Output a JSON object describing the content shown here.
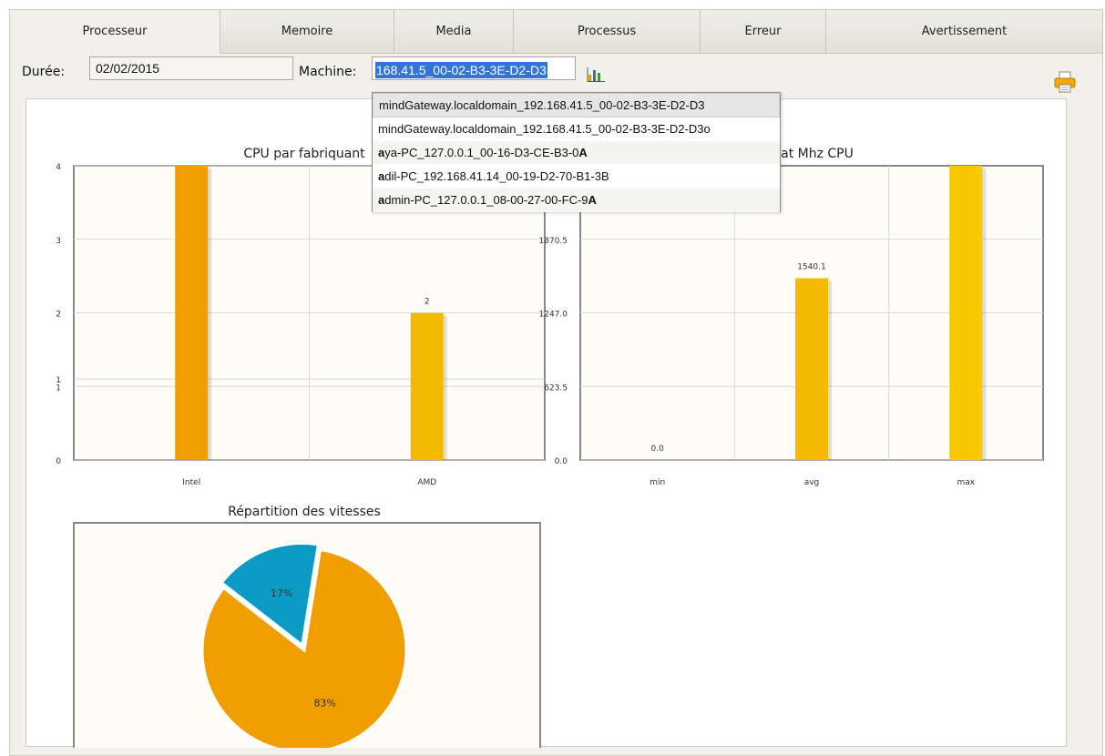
{
  "tabs": [
    "Processeur",
    "Memoire",
    "Media",
    "Processus",
    "Erreur",
    "Avertissement"
  ],
  "filter": {
    "duree_label": "Durée:",
    "duree_value": "02/02/2015",
    "machine_label": "Machine:",
    "machine_value": "168.41.5_00-02-B3-3E-D2-D3"
  },
  "icons": {
    "chart": "bar-chart-icon",
    "print": "printer-icon"
  },
  "dropdown": {
    "items": [
      {
        "text": "mindGateway.localdomain_192.168.41.5_00-02-B3-3E-D2-D3",
        "prefix": "",
        "bold": ""
      },
      {
        "text": "mindGateway.localdomain_192.168.41.5_00-02-B3-3E-D2-D3o",
        "prefix": "",
        "bold": ""
      },
      {
        "text": "aya-PC_127.0.0.1_00-16-D3-CE-B3-0",
        "prefix": "a",
        "bold": "A"
      },
      {
        "text": "adil-PC_192.168.41.14_00-19-D2-70-B1-3B",
        "prefix": "a",
        "bold": ""
      },
      {
        "text": "admin-PC_127.0.0.1_08-00-27-00-FC-9",
        "prefix": "a",
        "bold": "A"
      }
    ]
  },
  "colors": {
    "orange": "#f09e00",
    "yellow": "#f2bb00",
    "gold": "#f8c800",
    "blue": "#0a9ac4",
    "plot_bg": "#fdfcf6"
  },
  "chart_data": [
    {
      "type": "bar",
      "title": "CPU par fabriquant",
      "categories": [
        "Intel",
        "AMD"
      ],
      "values": [
        4,
        2
      ],
      "data_labels": [
        "",
        "2"
      ],
      "yticks": [
        "0",
        "1",
        "1",
        "2",
        "3",
        "4"
      ],
      "ylim": [
        0,
        4
      ]
    },
    {
      "type": "bar",
      "title": "at Mhz CPU",
      "categories": [
        "min",
        "avg",
        "max"
      ],
      "values": [
        0.0,
        1540.1,
        2494
      ],
      "data_labels": [
        "0.0",
        "1540.1",
        ""
      ],
      "yticks": [
        "0.0",
        "623.5",
        "1247.0",
        "1870.5"
      ],
      "ylim": [
        0,
        2494
      ]
    },
    {
      "type": "pie",
      "title": "Répartition des vitesses",
      "slices": [
        {
          "label": "83%",
          "value": 83
        },
        {
          "label": "17%",
          "value": 17
        }
      ]
    }
  ]
}
